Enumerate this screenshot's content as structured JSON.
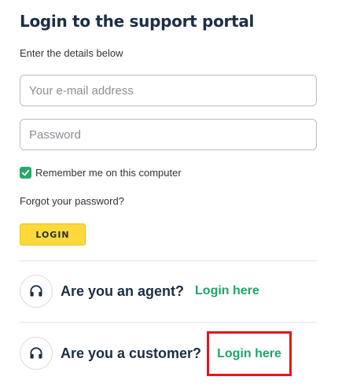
{
  "title": "Login to the support portal",
  "subtitle": "Enter the details below",
  "form": {
    "email_placeholder": "Your e-mail address",
    "password_placeholder": "Password",
    "remember_label": "Remember me on this computer",
    "remember_checked": true,
    "forgot_label": "Forgot your password?",
    "login_button": "LOGIN"
  },
  "roles": {
    "agent": {
      "question": "Are you an agent?",
      "link": "Login here",
      "icon": "headset-icon"
    },
    "customer": {
      "question": "Are you a customer?",
      "link": "Login here",
      "icon": "headset-icon"
    }
  },
  "colors": {
    "accent_green": "#1ea56a",
    "button_yellow": "#ffd93a",
    "highlight_red": "#e8141c",
    "heading_navy": "#1c2e45"
  }
}
